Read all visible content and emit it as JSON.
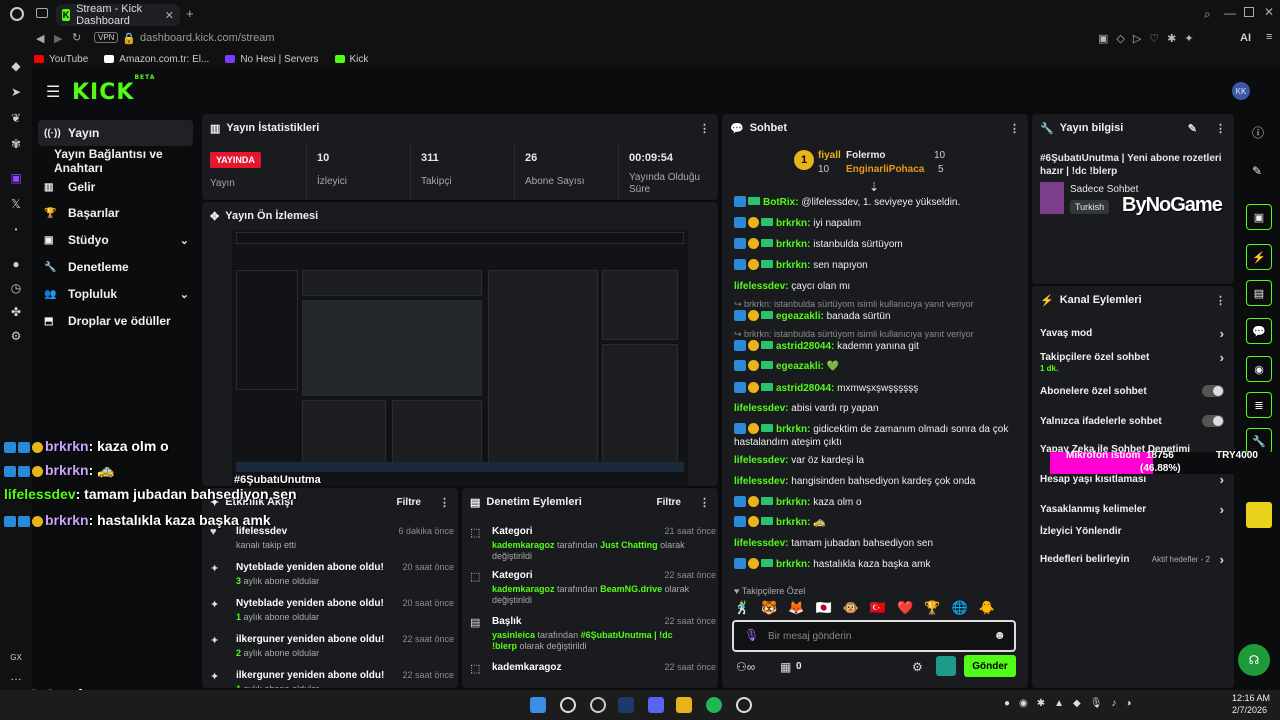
{
  "browser": {
    "tab_title": "Stream - Kick Dashboard",
    "url": "dashboard.kick.com/stream",
    "vpn": "VPN",
    "ai": "AI",
    "bookmarks": [
      {
        "label": "YouTube",
        "color": "#ff0000"
      },
      {
        "label": "Amazon.com.tr: El...",
        "color": "#ffffff"
      },
      {
        "label": "No Hesi | Servers",
        "color": "#7a3cff"
      },
      {
        "label": "Kick",
        "color": "#53fc18"
      }
    ]
  },
  "nav": {
    "items": [
      {
        "label": "Yayın",
        "icon": "broadcast-icon"
      },
      {
        "label": "Yayın Bağlantısı ve Anahtarı",
        "icon": ""
      },
      {
        "label": "Gelir",
        "icon": "chart-icon"
      },
      {
        "label": "Başarılar",
        "icon": "trophy-icon"
      },
      {
        "label": "Stüdyo",
        "icon": "studio-icon"
      },
      {
        "label": "Denetleme",
        "icon": "wrench-icon"
      },
      {
        "label": "Topluluk",
        "icon": "community-icon"
      },
      {
        "label": "Droplar ve ödüller",
        "icon": "drops-icon"
      }
    ]
  },
  "stats": {
    "title": "Yayın İstatistikleri",
    "live_badge": "YAYINDA",
    "live_label": "Yayın",
    "viewers": "10",
    "viewers_label": "İzleyici",
    "followers": "311",
    "followers_label": "Takipçi",
    "subs": "26",
    "subs_label": "Abone Sayısı",
    "uptime": "00:09:54",
    "uptime_label": "Yayında Olduğu Süre"
  },
  "preview": {
    "title": "Yayın Ön İzlemesi",
    "tag": "#6ŞubatıUnutma"
  },
  "activity": {
    "title": "Etkinlik Akışı",
    "filter": "Filtre",
    "rows": [
      {
        "title": "lifelessdev",
        "sub": "kanalı takip etti",
        "time": "6 dakika önce",
        "icon": "heart-icon"
      },
      {
        "title": "Nyteblade yeniden abone oldu!",
        "sub_num": "3",
        "sub": "aylık abone oldular",
        "time": "20 saat önce",
        "icon": "star-icon"
      },
      {
        "title": "Nyteblade yeniden abone oldu!",
        "sub_num": "1",
        "sub": "aylık abone oldular",
        "time": "20 saat önce",
        "icon": "star-icon"
      },
      {
        "title": "ilkerguner yeniden abone oldu!",
        "sub_num": "2",
        "sub": "aylık abone oldular",
        "time": "22 saat önce",
        "icon": "star-icon"
      },
      {
        "title": "ilkerguner yeniden abone oldu!",
        "sub_num": "1",
        "sub": "aylık abone oldular",
        "time": "22 saat önce",
        "icon": "star-icon"
      }
    ]
  },
  "moderation": {
    "title": "Denetim Eylemleri",
    "filter": "Filtre",
    "rows": [
      {
        "title": "Kategori",
        "actor": "kademkaragoz",
        "mid": "tarafından",
        "value": "Just Chatting",
        "end": "olarak değiştirildi",
        "time": "21 saat önce"
      },
      {
        "title": "Kategori",
        "actor": "kademkaragoz",
        "mid": "tarafından",
        "value": "BeamNG.drive",
        "end": "olarak değiştirildi",
        "time": "22 saat önce"
      },
      {
        "title": "Başlık",
        "actor": "yasinleica",
        "mid": "tarafından",
        "value": "#6ŞubatıUnutma | !dc !blerp",
        "end": "olarak değiştirildi",
        "time": "22 saat önce"
      },
      {
        "title": "kademkaragoz",
        "actor": "",
        "mid": "",
        "value": "",
        "end": "",
        "time": "22 saat önce"
      }
    ]
  },
  "chat": {
    "title": "Sohbet",
    "top": {
      "user1": "fiyall",
      "user1_count": "10",
      "user2": "Folermo",
      "user2_count": "10",
      "user3": "EnginarliPohaca",
      "user3_count": "5"
    },
    "lines": [
      {
        "user": "BotRix:",
        "text": " @lifelessdev, 1. seviyeye yükseldin."
      },
      {
        "user": "brkrkn:",
        "text": " iyi napalım"
      },
      {
        "user": "brkrkn:",
        "text": " istanbulda sürtüyom"
      },
      {
        "user": "brkrkn:",
        "text": " sen napıyon"
      },
      {
        "user": "lifelessdev:",
        "text": " çaycı olan mı"
      },
      {
        "reply": "brkrkn: istanbulda sürtüyom isimli kullanıcıya yanıt veriyor"
      },
      {
        "user": "egeazakli:",
        "text": " banada sürtün"
      },
      {
        "reply": "brkrkn: istanbulda sürtüyom isimli kullanıcıya yanıt veriyor"
      },
      {
        "user": "astrid28044:",
        "text": " kademn yanına git"
      },
      {
        "user": "egeazakli:",
        "text": " 💚"
      },
      {
        "user": "astrid28044:",
        "text": " mxmwşxşwşşşşşş"
      },
      {
        "user": "lifelessdev:",
        "text": " abisi vardı rp yapan"
      },
      {
        "user": "brkrkn:",
        "text": " gidicektim de zamanım olmadı sonra da çok hastalandım ateşim çıktı"
      },
      {
        "user": "lifelessdev:",
        "text": " var öz kardeşi la"
      },
      {
        "user": "lifelessdev:",
        "text": " hangisinden bahsediyon kardeş çok onda"
      },
      {
        "user": "brkrkn:",
        "text": " kaza olm o"
      },
      {
        "user": "brkrkn:",
        "text": " 🚕"
      },
      {
        "user": "lifelessdev:",
        "text": " tamam jubadan bahsediyon sen"
      },
      {
        "user": "brkrkn:",
        "text": " hastalıkla kaza başka amk"
      }
    ],
    "followers_only": "Takipçilere Özel",
    "input_placeholder": "Bir mesaj gönderin",
    "count": "0",
    "send": "Gönder"
  },
  "info": {
    "title": "Yayın bilgisi",
    "stream_title": "#6ŞubatıUnutma | Yeni abone rozetleri hazır | !dc !blerp",
    "category": "Sadece Sohbet",
    "language": "Turkish",
    "watermark": "ByNoGame"
  },
  "actions": {
    "title": "Kanal Eylemleri",
    "items": [
      {
        "label": "Yavaş mod",
        "kind": "arrow"
      },
      {
        "label": "Takipçilere özel sohbet",
        "sub": "1 dk.",
        "kind": "arrow"
      },
      {
        "label": "Abonelere özel sohbet",
        "kind": "toggle"
      },
      {
        "label": "Yalnızca ifadelerle sohbet",
        "kind": "toggle"
      },
      {
        "label": "Yapay Zeka ile Sohbet Denetimi",
        "kind": "none"
      },
      {
        "label": "Hesap yaşı kısıtlaması",
        "kind": "arrow"
      },
      {
        "label": "Yasaklanmış kelimeler",
        "kind": "arrow"
      },
      {
        "label": "İzleyici Yönlendir",
        "kind": "none"
      },
      {
        "label": "Hedefleri belirleyin",
        "extra": "Aktif hedefler - 2",
        "kind": "arrow"
      }
    ]
  },
  "overlay": {
    "lines": [
      {
        "user": "brkrkn",
        "text": ": kaza olm o"
      },
      {
        "user": "brkrkn",
        "text": ": 🚕"
      },
      {
        "user": "lifelessdev",
        "text": ": tamam jubadan bahsediyon sen"
      },
      {
        "user": "brkrkn",
        "text": ": hastalıkla kaza başka amk"
      }
    ],
    "hashtag": "#6Şubatıunutma",
    "goal_label": "Mikrofon istiom",
    "goal_value": "18756",
    "goal_target": "TRY4000",
    "goal_percent": "(46.88%)",
    "goal_fraction": 0.4688
  },
  "taskbar": {
    "time": "12:16 AM",
    "date": "2/7/2026"
  },
  "colors": {
    "accent": "#53fc18",
    "live": "#e5172e",
    "overlay_pink": "#ff00d4"
  }
}
